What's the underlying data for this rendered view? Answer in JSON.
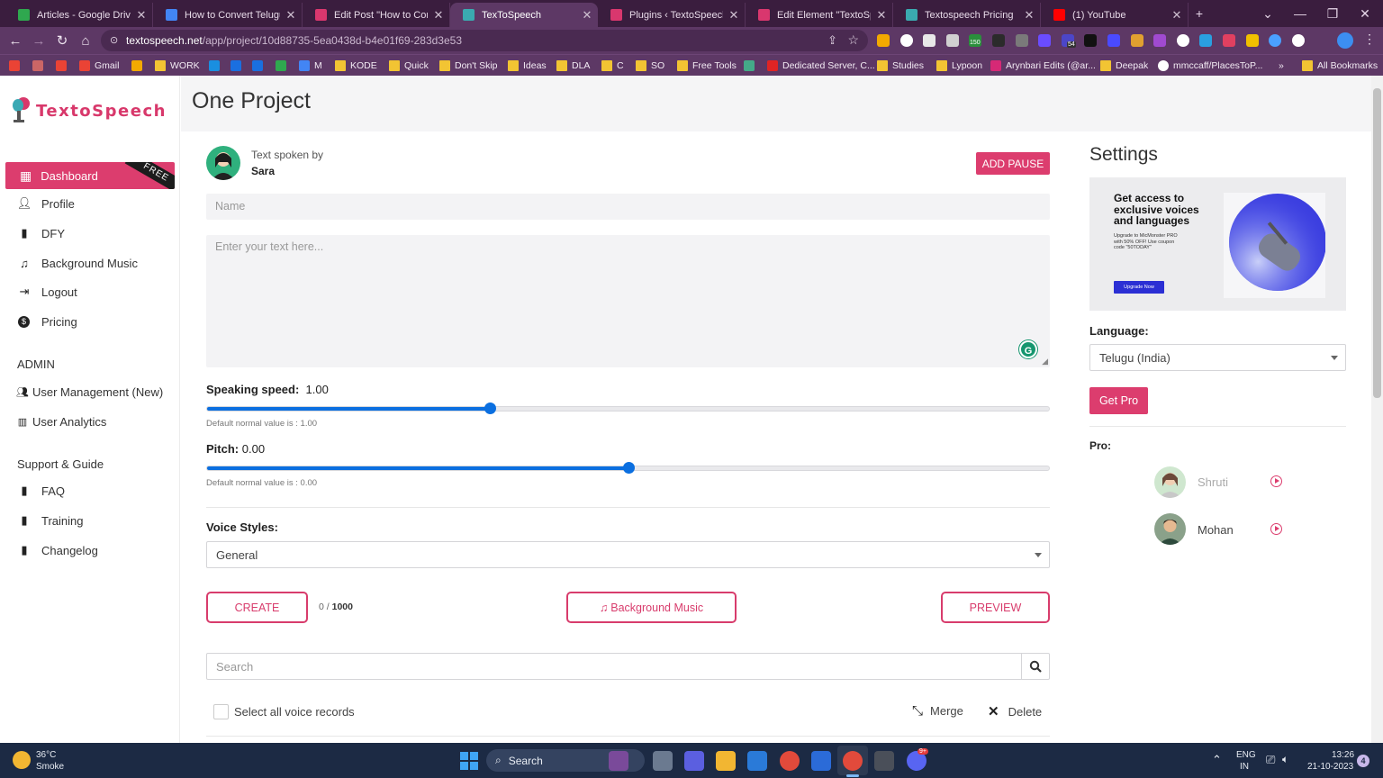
{
  "browser": {
    "tabs": [
      {
        "title": "Articles - Google Drive",
        "icon": "google-drive-icon",
        "color": "#2fa84f",
        "active": false
      },
      {
        "title": "How to Convert Telugu Te",
        "icon": "google-docs-icon",
        "color": "#4285f4",
        "active": false
      },
      {
        "title": "Edit Post \"How to Convert",
        "icon": "wordpress-admin-icon",
        "color": "#d9376e",
        "active": false
      },
      {
        "title": "TexToSpeech",
        "icon": "textospeech-icon",
        "color": "#3aaab0",
        "active": true
      },
      {
        "title": "Plugins ‹ TextoSpeech — \\",
        "icon": "wordpress-admin-icon",
        "color": "#d9376e",
        "active": false
      },
      {
        "title": "Edit Element \"TextoSpeec",
        "icon": "wordpress-admin-icon",
        "color": "#d9376e",
        "active": false
      },
      {
        "title": "Textospeech Pricing",
        "icon": "textospeech-icon",
        "color": "#3aaab0",
        "active": false
      },
      {
        "title": "(1) YouTube",
        "icon": "youtube-icon",
        "color": "#ff0000",
        "active": false
      }
    ],
    "new_tab_label": "+",
    "url_domain": "textospeech.net",
    "url_path": "/app/project/10d88735-5ea0438d-b4e01f69-283d3e53",
    "extension_badges": [
      "150",
      "54"
    ],
    "bookmarks": [
      {
        "label": "",
        "kind": "google-icon",
        "color": "#ea4335"
      },
      {
        "label": "",
        "kind": "calendar-icon",
        "color": "#c66"
      },
      {
        "label": "",
        "kind": "gmail-icon",
        "color": "#ea4335"
      },
      {
        "label": "Gmail",
        "kind": "gmail-icon",
        "color": "#ea4335"
      },
      {
        "label": "",
        "kind": "bookmark-icon",
        "color": "#f2a900"
      },
      {
        "label": "WORK",
        "kind": "folder"
      },
      {
        "label": "",
        "kind": "skype-icon",
        "color": "#1a8fe0"
      },
      {
        "label": "",
        "kind": "meta-icon",
        "color": "#1a6fe0"
      },
      {
        "label": "",
        "kind": "meta-icon",
        "color": "#1a6fe0"
      },
      {
        "label": "",
        "kind": "drive-icon",
        "color": "#2fa84f"
      },
      {
        "label": "M",
        "kind": "docs-icon",
        "color": "#4285f4"
      },
      {
        "label": "KODE",
        "kind": "folder"
      },
      {
        "label": "Quick",
        "kind": "folder"
      },
      {
        "label": "Don't Skip",
        "kind": "folder"
      },
      {
        "label": "Ideas",
        "kind": "folder"
      },
      {
        "label": "DLA",
        "kind": "folder"
      },
      {
        "label": "C",
        "kind": "folder"
      },
      {
        "label": "SO",
        "kind": "folder"
      },
      {
        "label": "Free Tools",
        "kind": "folder"
      },
      {
        "label": "",
        "kind": "globe-icon",
        "color": "#4a8"
      },
      {
        "label": "Dedicated Server, C...",
        "kind": "hosting-icon",
        "color": "#e02424"
      },
      {
        "label": "Studies",
        "kind": "folder"
      },
      {
        "label": "Lypoon",
        "kind": "folder"
      },
      {
        "label": "Arynbari Edits (@ar...",
        "kind": "instagram-icon",
        "color": "#d62976"
      },
      {
        "label": "Deepak",
        "kind": "folder"
      },
      {
        "label": "mmccaff/PlacesToP...",
        "kind": "github-icon",
        "color": "#ffffff"
      }
    ],
    "bookmarks_overflow": "»",
    "all_bookmarks": "All Bookmarks"
  },
  "sidebar": {
    "logo_text": "TextoSpeech",
    "active_item": "Dashboard",
    "active_ribbon": "FREE",
    "items": [
      {
        "label": "Profile",
        "icon": "user-icon"
      },
      {
        "label": "DFY",
        "icon": "file-icon"
      },
      {
        "label": "Background Music",
        "icon": "music-icon"
      },
      {
        "label": "Logout",
        "icon": "logout-icon"
      },
      {
        "label": "Pricing",
        "icon": "dollar-icon"
      }
    ],
    "admin_heading": "ADMIN",
    "admin_items": [
      {
        "label": "User Management (New)",
        "icon": "users-icon"
      },
      {
        "label": "User Analytics",
        "icon": "bar-chart-icon"
      }
    ],
    "support_heading": "Support & Guide",
    "support_items": [
      {
        "label": "FAQ",
        "icon": "file-icon"
      },
      {
        "label": "Training",
        "icon": "file-icon"
      },
      {
        "label": "Changelog",
        "icon": "file-icon"
      }
    ]
  },
  "page": {
    "title": "One Project"
  },
  "editor": {
    "spoken_by_label": "Text spoken by",
    "speaker": "Sara",
    "add_pause": "ADD PAUSE",
    "name_placeholder": "Name",
    "text_placeholder": "Enter your text here...",
    "speed_label": "Speaking speed:",
    "speed_value": "1.00",
    "speed_fraction": 0.336,
    "speed_hint": "Default normal value is : 1.00",
    "pitch_label": "Pitch:",
    "pitch_value": "0.00",
    "pitch_fraction": 0.5,
    "pitch_hint": "Default normal value is : 0.00",
    "voice_styles_label": "Voice Styles:",
    "voice_style": "General",
    "create": "CREATE",
    "char_count": "0",
    "char_sep": " / ",
    "char_max": "1000",
    "bg_music": "Background Music",
    "preview": "PREVIEW",
    "search_placeholder": "Search",
    "select_all": "Select all voice records",
    "merge": "Merge",
    "delete": "Delete"
  },
  "settings": {
    "title": "Settings",
    "promo_headline": "Get access to exclusive voices and languages",
    "promo_sub": "Upgrade to MicMonster PRO with 50% OFF! Use coupon code \"50TODAY\"",
    "promo_button": "Upgrade Now",
    "language_label": "Language:",
    "language_value": "Telugu (India)",
    "get_pro": "Get Pro",
    "pro_label": "Pro:",
    "pro_voices": [
      {
        "name": "Shruti"
      },
      {
        "name": "Mohan"
      }
    ]
  },
  "taskbar": {
    "weather_temp": "36°C",
    "weather_desc": "Smoke",
    "search_label": "Search",
    "lang_top": "ENG",
    "lang_bottom": "IN",
    "time": "13:26",
    "date": "21-10-2023",
    "notif_count": "4",
    "discord_badge": "9+"
  },
  "colors": {
    "accent": "#dc3d6e",
    "slider": "#0b6fe0",
    "chrome": "#5d3865"
  }
}
